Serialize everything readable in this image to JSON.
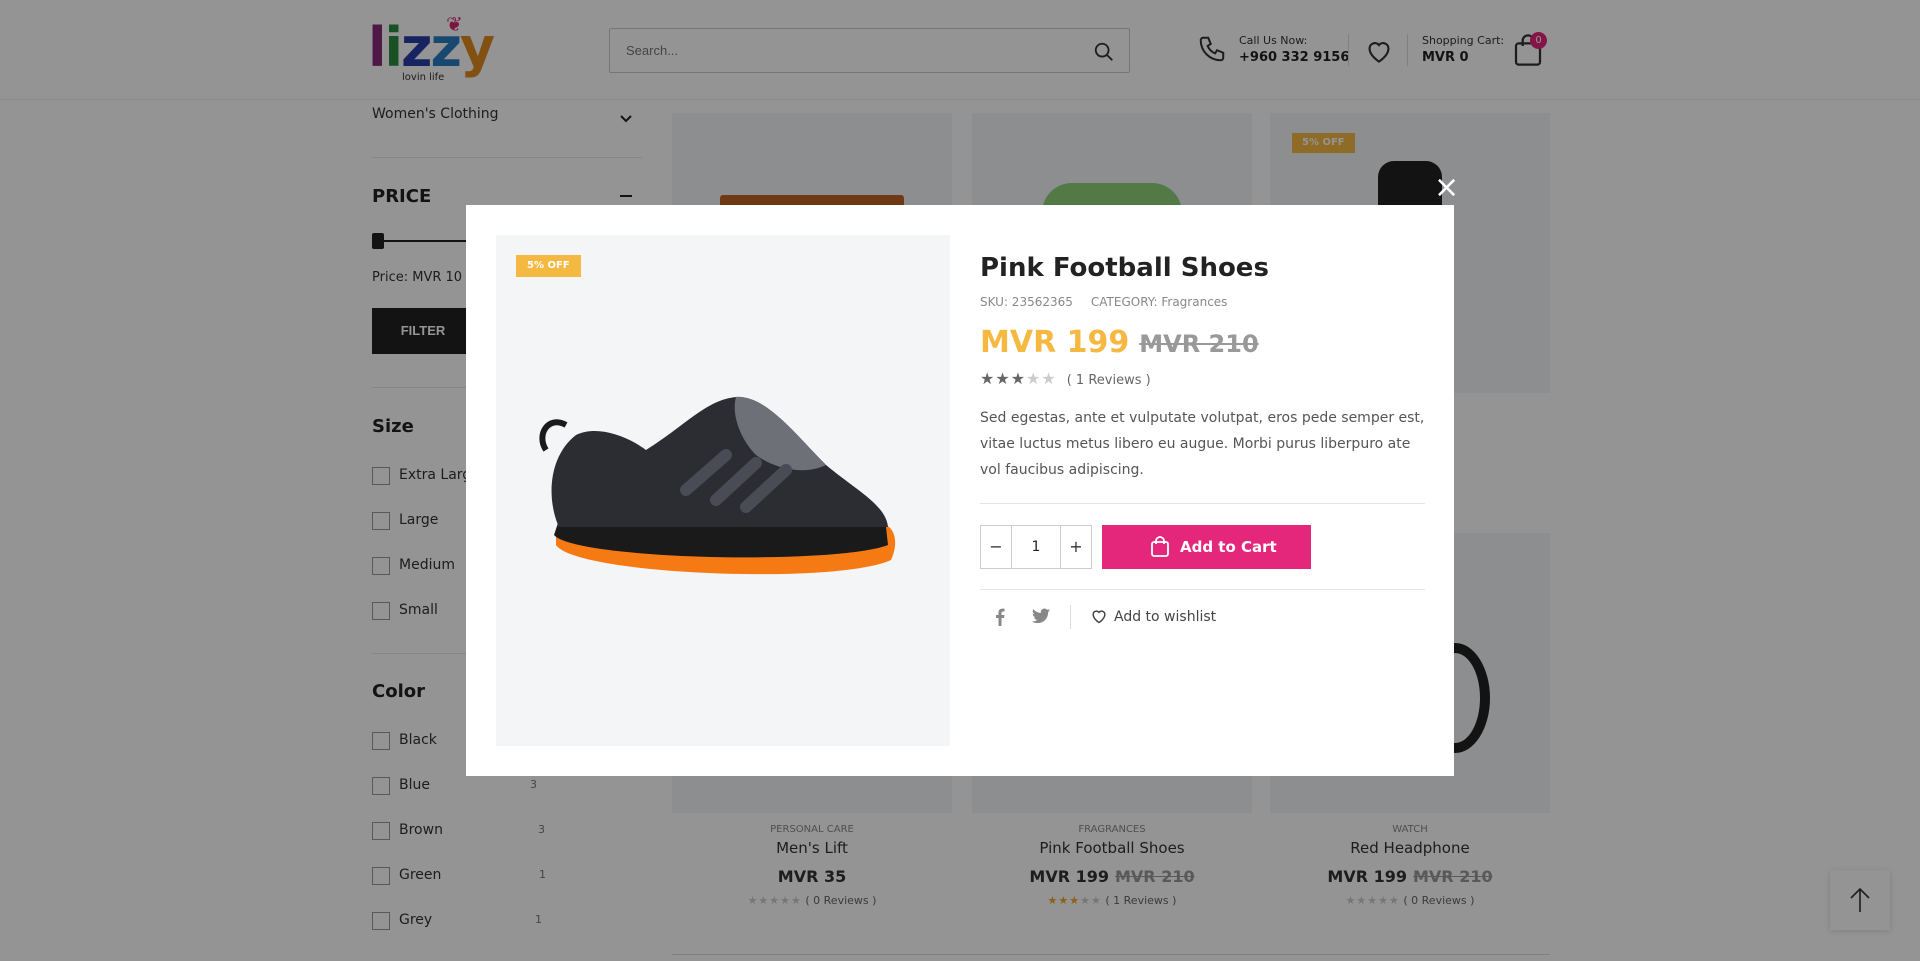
{
  "header": {
    "logo_text": "lizzy",
    "logo_tagline": "lovin life",
    "search_placeholder": "Search...",
    "call_label": "Call Us Now:",
    "call_number": "+960 332 9156",
    "cart_label": "Shopping Cart:",
    "cart_total": "MVR 0",
    "cart_count": "0"
  },
  "sidebar": {
    "category_label": "Women's Clothing",
    "price_title": "PRICE",
    "price_range_text": "Price: MVR 10 —",
    "filter_label": "FILTER",
    "size_title": "Size",
    "sizes": [
      "Extra Large",
      "Large",
      "Medium",
      "Small"
    ],
    "color_title": "Color",
    "colors": [
      {
        "label": "Black",
        "count": ""
      },
      {
        "label": "Blue",
        "count": "3"
      },
      {
        "label": "Brown",
        "count": "3"
      },
      {
        "label": "Green",
        "count": "1"
      },
      {
        "label": "Grey",
        "count": "1"
      }
    ]
  },
  "grid": {
    "top_badge": "5% OFF",
    "partial_info": {
      "cat": "G",
      "name": "tch",
      "old": "210",
      "rev": "ws )"
    },
    "products": [
      {
        "category": "PERSONAL CARE",
        "name": "Men's Lift",
        "price": "MVR  35",
        "old_price": "",
        "rating": 0,
        "reviews": "( 0 Reviews )"
      },
      {
        "category": "FRAGRANCES",
        "name": "Pink Football Shoes",
        "price": "MVR  199",
        "old_price": "MVR  210",
        "rating": 3,
        "reviews": "( 1 Reviews )"
      },
      {
        "category": "WATCH",
        "name": "Red Headphone",
        "price": "MVR  199",
        "old_price": "MVR  210",
        "rating": 0,
        "reviews": "( 0 Reviews )"
      }
    ]
  },
  "modal": {
    "badge": "5% OFF",
    "title": "Pink Football Shoes",
    "sku": "SKU: 23562365",
    "category": "CATEGORY: Fragrances",
    "price": "MVR  199",
    "old_price": "MVR  210",
    "rating": 3,
    "reviews": "( 1 Reviews )",
    "description": "Sed egestas, ante et vulputate volutpat, eros pede semper est, vitae luctus metus libero eu augue. Morbi purus liberpuro ate vol faucibus adipiscing.",
    "quantity": "1",
    "add_to_cart": "Add to Cart",
    "add_to_wishlist": "Add to wishlist",
    "close_label": "×"
  },
  "colors": {
    "accent_pink": "#e4277b",
    "badge_yellow": "#f5b942",
    "dark": "#222222"
  }
}
